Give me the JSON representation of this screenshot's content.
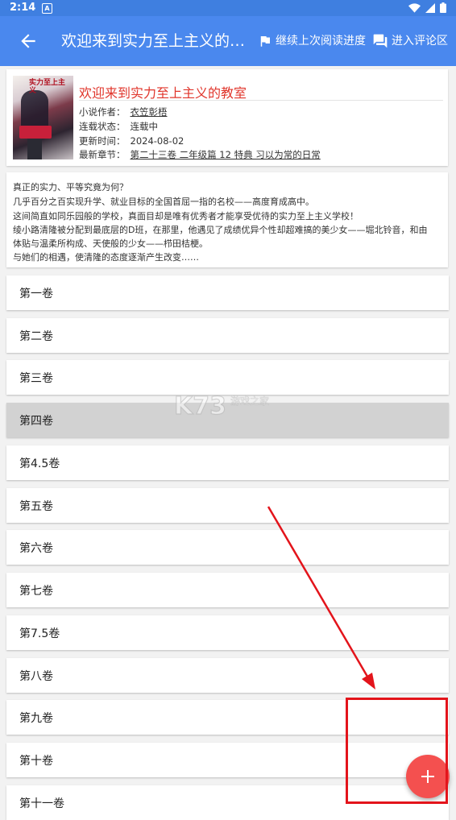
{
  "status_bar": {
    "time": "2:14",
    "notif_glyph": "A"
  },
  "toolbar": {
    "title": "欢迎来到实力至上主义的教室",
    "resume_label": "继续上次阅读进度",
    "comments_label": "进入评论区"
  },
  "novel": {
    "title": "欢迎来到实力至上主义的教室",
    "cover_text": "实力至上主义",
    "author_label": "小说作者：",
    "author": "衣笠彰梧",
    "status_label": "连载状态：",
    "status": "连载中",
    "updated_label": "更新时间：",
    "updated": "2024-08-02",
    "latest_label": "最新章节：",
    "latest": "第二十三卷 二年级篇 12 特典 习以为常的日常"
  },
  "description": {
    "line1": "真正的实力、平等究竟为何？",
    "line2": "几乎百分之百实现升学、就业目标的全国首屈一指的名校——高度育成高中。",
    "line3": "这间简直如同乐园般的学校，真面目却是唯有优秀者才能享受优待的实力至上主义学校！",
    "line4": "绫小路清隆被分配到最底层的D班，在那里，他遇见了成绩优异个性却超难搞的美少女——堀北铃音，和由",
    "line5": "体贴与温柔所构成、天使般的少女——栉田桔梗。",
    "line6": "与她们的相遇，使清隆的态度逐渐产生改变……"
  },
  "volumes": {
    "v1": "第一卷",
    "v2": "第二卷",
    "v3": "第三卷",
    "v4": "第四卷",
    "v45": "第4.5卷",
    "v5": "第五卷",
    "v6": "第六卷",
    "v7": "第七卷",
    "v75": "第7.5卷",
    "v8": "第八卷",
    "v9": "第九卷",
    "v10": "第十卷",
    "v11": "第十一卷"
  },
  "watermark": {
    "brand": "K73",
    "sub": "游戏之家"
  },
  "icons": {
    "back": "arrow-left-icon",
    "resume": "flag-icon",
    "comments": "forum-icon",
    "fab": "plus-icon"
  },
  "colors": {
    "toolbar": "#4a88ee",
    "title_red": "#e0352b",
    "fab": "#f4504f",
    "annotation": "#e3141b",
    "selected_row": "#d2d2d2"
  }
}
